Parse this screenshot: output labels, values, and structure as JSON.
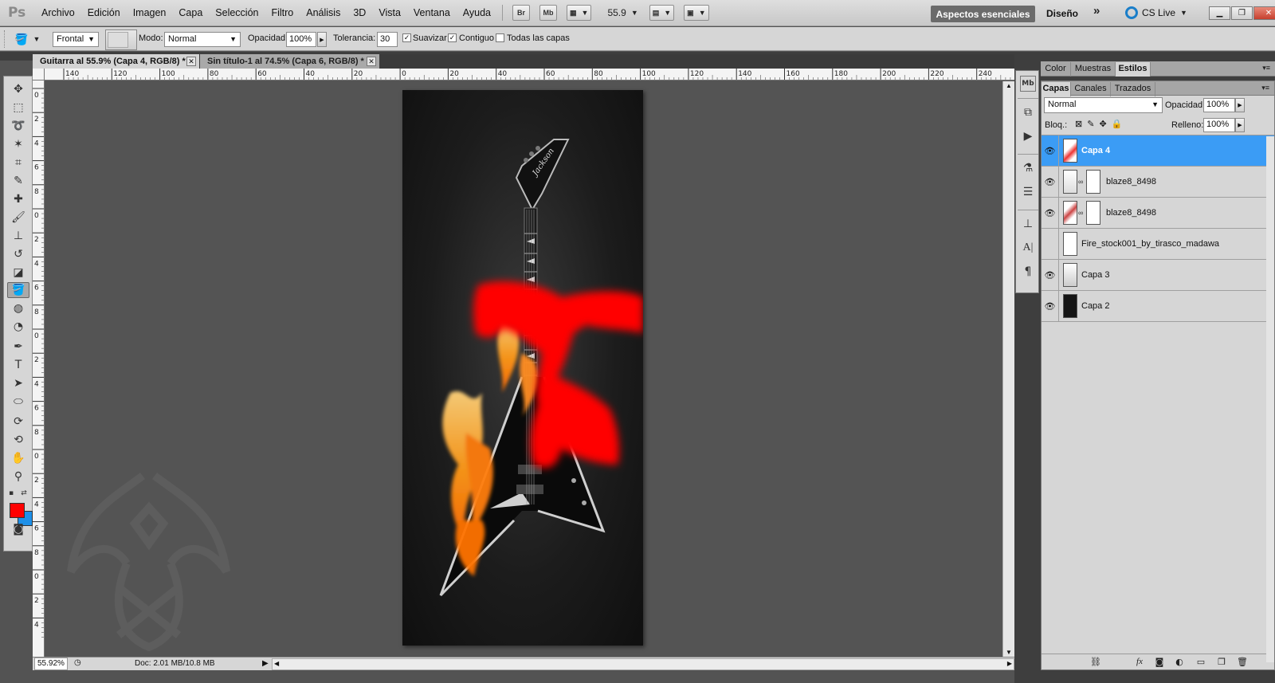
{
  "menubar": {
    "logo": "Ps",
    "items": [
      "Archivo",
      "Edición",
      "Imagen",
      "Capa",
      "Selección",
      "Filtro",
      "Análisis",
      "3D",
      "Vista",
      "Ventana",
      "Ayuda"
    ],
    "bridge_label": "Br",
    "minibridge_label": "Mb",
    "zoom": "55.9",
    "workspace_active": "Aspectos esenciales",
    "workspace_design": "Diseño",
    "more": "»",
    "cslive": "CS Live"
  },
  "options": {
    "source": "Frontal",
    "mode_label": "Modo:",
    "mode_value": "Normal",
    "opacity_label": "Opacidad:",
    "opacity_value": "100%",
    "tolerance_label": "Tolerancia:",
    "tolerance_value": "30",
    "antialias_label": "Suavizar",
    "contiguous_label": "Contiguo",
    "all_layers_label": "Todas las capas"
  },
  "doctabs": [
    {
      "label": "Guitarra al 55.9% (Capa 4, RGB/8) *"
    },
    {
      "label": "Sin título-1 al 74.5% (Capa 6, RGB/8) *"
    }
  ],
  "ruler_h_ticks": [
    "140",
    "120",
    "100",
    "80",
    "60",
    "40",
    "20",
    "0",
    "20",
    "40",
    "60",
    "80",
    "100",
    "120",
    "140",
    "160",
    "180",
    "200",
    "220",
    "240"
  ],
  "ruler_v_ticks": [
    "0",
    "2",
    "4",
    "6",
    "8",
    "0",
    "2",
    "4",
    "6",
    "8",
    "0",
    "2",
    "4",
    "6",
    "8",
    "0",
    "2",
    "4",
    "6",
    "8",
    "0",
    "2",
    "4"
  ],
  "status": {
    "zoom": "55.92%",
    "doc": "Doc: 2.01 MB/10.8 MB"
  },
  "panel_top_tabs": [
    "Color",
    "Muestras",
    "Estilos"
  ],
  "layers_panel": {
    "tabs": [
      "Capas",
      "Canales",
      "Trazados"
    ],
    "blend_mode": "Normal",
    "opacity_label": "Opacidad:",
    "opacity_value": "100%",
    "lock_label": "Bloq.:",
    "fill_label": "Relleno:",
    "fill_value": "100%",
    "layers": [
      {
        "name": "Capa 4",
        "visible": true,
        "selected": true,
        "mask": false
      },
      {
        "name": "blaze8_8498",
        "visible": true,
        "selected": false,
        "mask": true
      },
      {
        "name": "blaze8_8498",
        "visible": true,
        "selected": false,
        "mask": true
      },
      {
        "name": "Fire_stock001_by_tirasco_madawa",
        "visible": false,
        "selected": false,
        "mask": false
      },
      {
        "name": "Capa 3",
        "visible": true,
        "selected": false,
        "mask": false
      },
      {
        "name": "Capa 2",
        "visible": true,
        "selected": false,
        "mask": false
      }
    ]
  },
  "colors": {
    "foreground": "#ff0000",
    "background": "#1e90e8",
    "selected_layer": "#3b9cf5",
    "workspace_bg": "#545454"
  }
}
